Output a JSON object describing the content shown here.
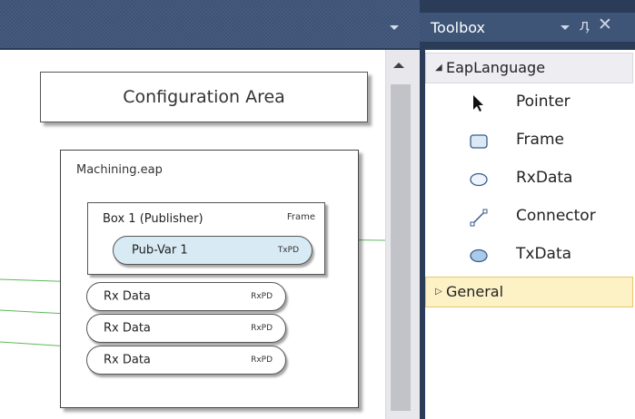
{
  "designer": {
    "config_area_label": "Configuration Area",
    "machining_label": "Machining.eap",
    "box1": {
      "title": "Box 1 (Publisher)",
      "type": "Frame"
    },
    "pub_var": {
      "label": "Pub-Var 1",
      "type": "TxPD"
    },
    "rx_items": [
      {
        "label": "Rx Data",
        "type": "RxPD"
      },
      {
        "label": "Rx Data",
        "type": "RxPD"
      },
      {
        "label": "Rx Data",
        "type": "RxPD"
      }
    ]
  },
  "toolbox": {
    "title": "Toolbox",
    "categories": [
      {
        "label": "EapLanguage",
        "expanded": true
      },
      {
        "label": "General",
        "expanded": false
      }
    ],
    "tools": [
      {
        "label": "Pointer",
        "icon": "pointer-icon"
      },
      {
        "label": "Frame",
        "icon": "frame-icon"
      },
      {
        "label": "RxData",
        "icon": "rxdata-icon"
      },
      {
        "label": "Connector",
        "icon": "connector-icon"
      },
      {
        "label": "TxData",
        "icon": "txdata-icon"
      }
    ]
  },
  "colors": {
    "frame_bg": "#2b3c59",
    "connector_line": "#5cb85c",
    "pub_var_fill": "#d8eaf4",
    "selected_category": "#fdf1c6"
  }
}
